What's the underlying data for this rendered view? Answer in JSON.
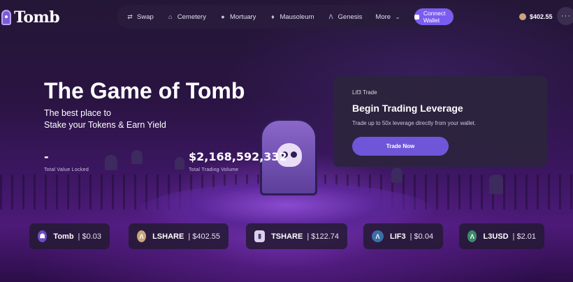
{
  "brand": {
    "name": "Tomb"
  },
  "nav": {
    "items": [
      {
        "label": "Swap",
        "icon": "swap-icon",
        "glyph": "⇄"
      },
      {
        "label": "Cemetery",
        "icon": "cemetery-icon",
        "glyph": "⌂"
      },
      {
        "label": "Mortuary",
        "icon": "mortuary-icon",
        "glyph": "●"
      },
      {
        "label": "Mausoleum",
        "icon": "mausoleum-icon",
        "glyph": "♦"
      },
      {
        "label": "Genesis",
        "icon": "genesis-icon",
        "glyph": "Λ"
      },
      {
        "label": "More",
        "icon": "chevron-down-icon",
        "glyph": "⌄"
      }
    ],
    "connect_label": "Connect Wallet"
  },
  "balance": {
    "value": "$402.55"
  },
  "more_glyph": "···",
  "hero": {
    "title": "The Game of Tomb",
    "subtitle_line1": "The best place to",
    "subtitle_line2": "Stake your Tokens & Earn Yield"
  },
  "stats": {
    "tvl": {
      "value": "-",
      "label": "Total Value Locked"
    },
    "volume": {
      "value": "$2,168,592,332",
      "label": "Total Trading Volume"
    }
  },
  "promo": {
    "tag": "Lif3 Trade",
    "title": "Begin Trading Leverage",
    "description": "Trade up to 50x leverage directly from your wallet.",
    "button": "Trade Now"
  },
  "tokens": [
    {
      "name": "Tomb",
      "price": "| $0.03",
      "icon": "tomb-token-icon",
      "glyph": "☗",
      "color": "#6a4bc4"
    },
    {
      "name": "LSHARE",
      "price": "| $402.55",
      "icon": "lshare-token-icon",
      "glyph": "Λ",
      "color": "#c9a57a"
    },
    {
      "name": "TSHARE",
      "price": "| $122.74",
      "icon": "tshare-token-icon",
      "glyph": "▮",
      "color": "#d9d2ea"
    },
    {
      "name": "LIF3",
      "price": "| $0.04",
      "icon": "lif3-token-icon",
      "glyph": "Λ",
      "color": "#3b6fa8"
    },
    {
      "name": "L3USD",
      "price": "| $2.01",
      "icon": "l3usd-token-icon",
      "glyph": "Λ",
      "color": "#3c8a6a"
    }
  ]
}
